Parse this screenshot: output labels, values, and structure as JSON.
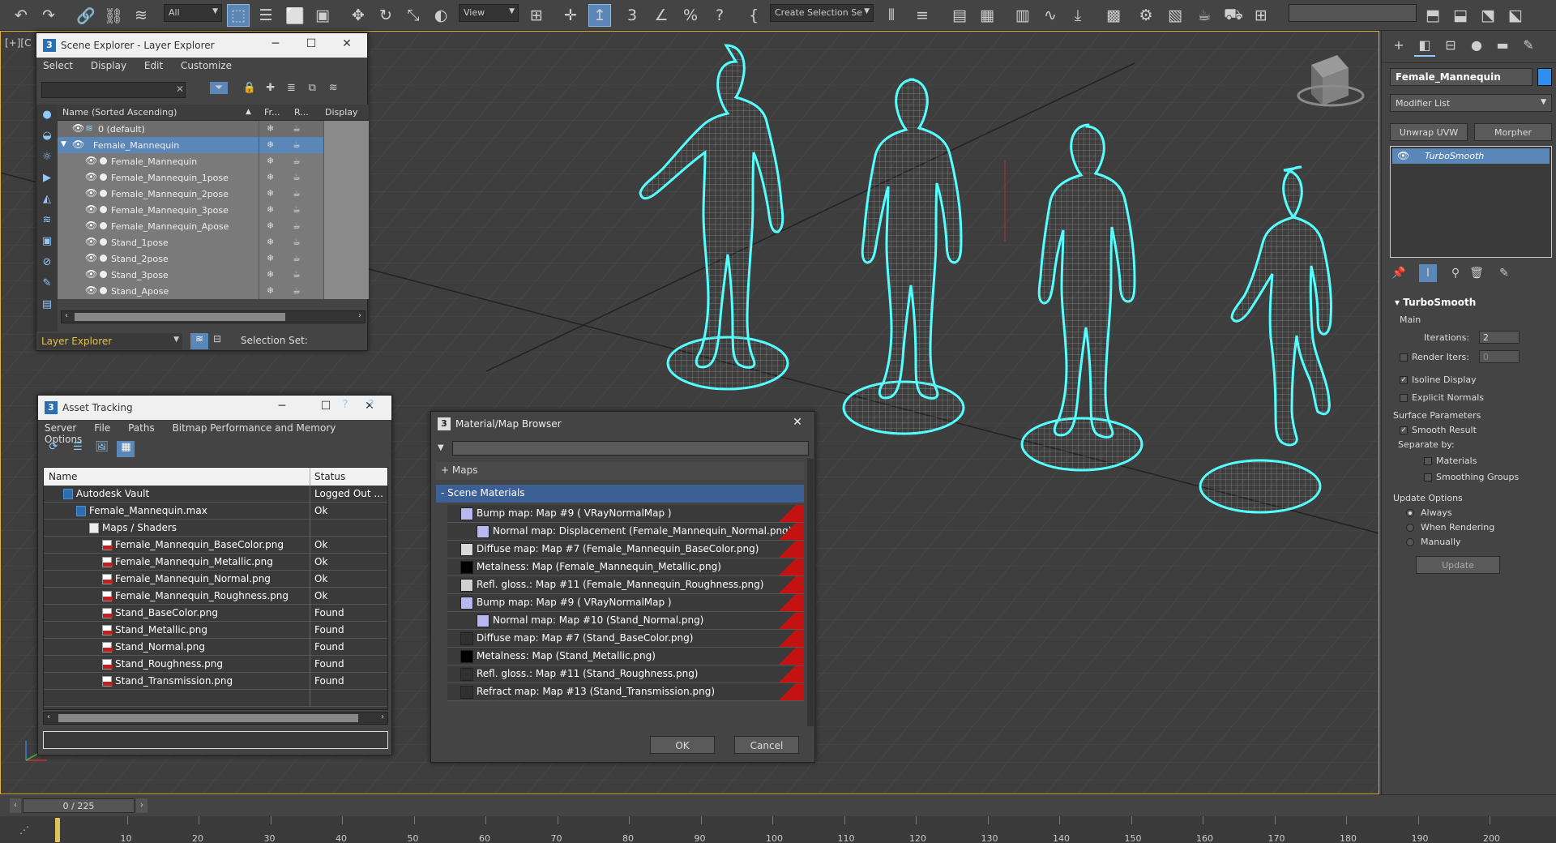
{
  "toolbar": {
    "filter_dropdown": "All",
    "view_dropdown": "View",
    "selection_set_dropdown": "Create Selection Se"
  },
  "viewport": {
    "label": "[+][C"
  },
  "command_panel": {
    "object_name": "Female_Mannequin",
    "object_color": "#2f8ef0",
    "modifier_list": "Modifier List",
    "buttons": [
      "Unwrap UVW",
      "Morpher"
    ],
    "stack": [
      "TurboSmooth"
    ],
    "turbosmooth": {
      "title": "TurboSmooth",
      "main_label": "Main",
      "iterations_label": "Iterations:",
      "iterations": "2",
      "render_iters_label": "Render Iters:",
      "render_iters": "0",
      "isoline_display": "Isoline Display",
      "explicit_normals": "Explicit Normals",
      "surface_params": "Surface Parameters",
      "smooth_result": "Smooth Result",
      "separate_by": "Separate by:",
      "materials": "Materials",
      "smoothing_groups": "Smoothing Groups",
      "update_options": "Update Options",
      "always": "Always",
      "when_rendering": "When Rendering",
      "manually": "Manually",
      "update_button": "Update"
    }
  },
  "scene_explorer": {
    "title": "Scene Explorer - Layer Explorer",
    "menu": [
      "Select",
      "Display",
      "Edit",
      "Customize"
    ],
    "columns": [
      "Name (Sorted Ascending)",
      "Fr...",
      "R...",
      "Display as"
    ],
    "rows": [
      {
        "name": "0 (default)",
        "kind": "layer"
      },
      {
        "name": "Female_Mannequin",
        "kind": "layer-selected"
      },
      {
        "name": "Female_Mannequin",
        "kind": "object"
      },
      {
        "name": "Female_Mannequin_1pose",
        "kind": "object"
      },
      {
        "name": "Female_Mannequin_2pose",
        "kind": "object"
      },
      {
        "name": "Female_Mannequin_3pose",
        "kind": "object"
      },
      {
        "name": "Female_Mannequin_Apose",
        "kind": "object"
      },
      {
        "name": "Stand_1pose",
        "kind": "object"
      },
      {
        "name": "Stand_2pose",
        "kind": "object"
      },
      {
        "name": "Stand_3pose",
        "kind": "object"
      },
      {
        "name": "Stand_Apose",
        "kind": "object"
      }
    ],
    "footer_explorer": "Layer Explorer",
    "footer_selection_set": "Selection Set:"
  },
  "asset_tracking": {
    "title": "Asset Tracking",
    "menu": [
      "Server",
      "File",
      "Paths",
      "Bitmap Performance and Memory",
      "Options"
    ],
    "columns": [
      "Name",
      "Status"
    ],
    "rows": [
      {
        "name": "Autodesk Vault",
        "status": "Logged Out ...",
        "indent": 1,
        "icon": "vault"
      },
      {
        "name": "Female_Mannequin.max",
        "status": "Ok",
        "indent": 2,
        "icon": "max"
      },
      {
        "name": "Maps / Shaders",
        "status": "",
        "indent": 3,
        "icon": "folder"
      },
      {
        "name": "Female_Mannequin_BaseColor.png",
        "status": "Ok",
        "indent": 4,
        "icon": "png"
      },
      {
        "name": "Female_Mannequin_Metallic.png",
        "status": "Ok",
        "indent": 4,
        "icon": "png"
      },
      {
        "name": "Female_Mannequin_Normal.png",
        "status": "Ok",
        "indent": 4,
        "icon": "png"
      },
      {
        "name": "Female_Mannequin_Roughness.png",
        "status": "Ok",
        "indent": 4,
        "icon": "png"
      },
      {
        "name": "Stand_BaseColor.png",
        "status": "Found",
        "indent": 4,
        "icon": "png"
      },
      {
        "name": "Stand_Metallic.png",
        "status": "Found",
        "indent": 4,
        "icon": "png"
      },
      {
        "name": "Stand_Normal.png",
        "status": "Found",
        "indent": 4,
        "icon": "png"
      },
      {
        "name": "Stand_Roughness.png",
        "status": "Found",
        "indent": 4,
        "icon": "png"
      },
      {
        "name": "Stand_Transmission.png",
        "status": "Found",
        "indent": 4,
        "icon": "png"
      }
    ]
  },
  "material_browser": {
    "title": "Material/Map Browser",
    "group_maps": "+ Maps",
    "group_scene": "- Scene Materials",
    "rows": [
      {
        "label": "Bump map: Map #9  ( VRayNormalMap )",
        "swatch": "#b8b8f0",
        "indent": 1
      },
      {
        "label": "Normal map: Displacement (Female_Mannequin_Normal.png)",
        "swatch": "#b8b8f0",
        "indent": 2
      },
      {
        "label": "Diffuse map: Map #7 (Female_Mannequin_BaseColor.png)",
        "swatch": "#d8d8d8",
        "indent": 1
      },
      {
        "label": "Metalness: Map (Female_Mannequin_Metallic.png)",
        "swatch": "#000000",
        "indent": 1
      },
      {
        "label": "Refl. gloss.: Map #11 (Female_Mannequin_Roughness.png)",
        "swatch": "#d0d0d0",
        "indent": 1
      },
      {
        "label": "Bump map: Map #9  ( VRayNormalMap )",
        "swatch": "#b8b8f0",
        "indent": 1
      },
      {
        "label": "Normal map: Map #10 (Stand_Normal.png)",
        "swatch": "#b8b8f0",
        "indent": 2
      },
      {
        "label": "Diffuse map: Map #7 (Stand_BaseColor.png)",
        "swatch": "#303030",
        "indent": 1
      },
      {
        "label": "Metalness: Map (Stand_Metallic.png)",
        "swatch": "#000000",
        "indent": 1
      },
      {
        "label": "Refl. gloss.: Map #11 (Stand_Roughness.png)",
        "swatch": "#303030",
        "indent": 1
      },
      {
        "label": "Refract map: Map #13 (Stand_Transmission.png)",
        "swatch": "#303030",
        "indent": 1
      }
    ],
    "ok": "OK",
    "cancel": "Cancel"
  },
  "timeline": {
    "frame": "0 / 225",
    "ticks": [
      "10",
      "20",
      "30",
      "40",
      "50",
      "60",
      "70",
      "80",
      "90",
      "100",
      "110",
      "120",
      "130",
      "140",
      "150",
      "160",
      "170",
      "180",
      "190",
      "200"
    ]
  }
}
